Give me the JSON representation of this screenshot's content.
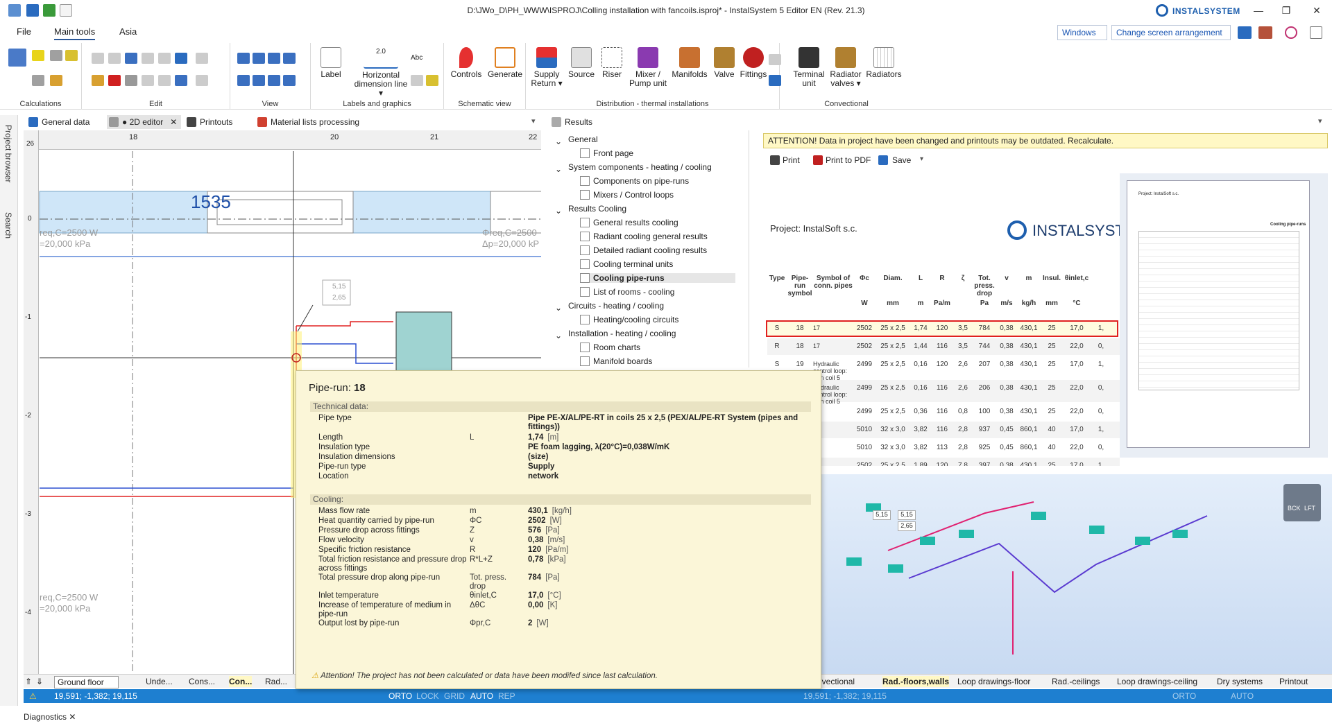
{
  "window": {
    "title": "D:\\JWo_D\\PH_WWW\\ISPROJ\\Colling installation with fancoils.isproj* - InstalSystem 5 Editor EN (Rev. 21.3)",
    "brand": "INSTALSYSTEM",
    "minimize": "—",
    "restore": "❐",
    "close": "✕"
  },
  "menu": {
    "file": "File",
    "main_tools": "Main tools",
    "asia": "Asia",
    "windows": "Windows ▾",
    "change_arrangement": "Change screen arrangement ▾"
  },
  "ribbon": {
    "groups": {
      "calculations": "Calculations",
      "edit": "Edit",
      "view": "View",
      "labels": "Labels and graphics",
      "schematic": "Schematic view",
      "distribution": "Distribution - thermal installations",
      "convectional": "Convectional"
    },
    "label": "Label",
    "horizontal_dimension": "Horizontal dimension line ▾",
    "dim_value": "2.0",
    "abc": "Abc",
    "controls": "Controls",
    "generate": "Generate",
    "supply_return": "Supply Return ▾",
    "source": "Source",
    "riser": "Riser",
    "mixer": "Mixer / Pump unit",
    "manifolds": "Manifolds",
    "valve": "Valve",
    "fittings": "Fittings",
    "terminal_unit": "Terminal unit",
    "radiator_valves": "Radiator valves ▾",
    "radiators": "Radiators"
  },
  "tabs": {
    "general_data": "General data",
    "editor_2d": "● 2D editor",
    "printouts": "Printouts",
    "material_lists": "Material lists processing",
    "results": "Results"
  },
  "side": {
    "project_browser": "Project browser",
    "search": "Search"
  },
  "canvas": {
    "ruler_top": [
      "18",
      "20",
      "21",
      "22"
    ],
    "ruler_left": [
      "26",
      "0",
      "-1",
      "-2",
      "-3",
      "-4"
    ],
    "room_number": "1535",
    "label1": "req,C=2500 W",
    "label2": "=20,000 kPa",
    "label3": "Φreq,C=2500",
    "label4": "Δp=20,000 kP",
    "label5": "req,C=2500 W",
    "label6": "=20,000 kPa",
    "dim_a": "5,15",
    "dim_b": "2,65"
  },
  "results_tree": [
    {
      "level": 0,
      "text": "General"
    },
    {
      "level": 1,
      "text": "Front page"
    },
    {
      "level": 0,
      "text": "System components - heating / cooling"
    },
    {
      "level": 1,
      "text": "Components on pipe-runs"
    },
    {
      "level": 1,
      "text": "Mixers / Control loops"
    },
    {
      "level": 0,
      "text": "Results Cooling"
    },
    {
      "level": 1,
      "text": "General results cooling"
    },
    {
      "level": 1,
      "text": "Radiant cooling general results"
    },
    {
      "level": 1,
      "text": "Detailed radiant cooling results"
    },
    {
      "level": 1,
      "text": "Cooling terminal units"
    },
    {
      "level": 1,
      "text": "Cooling pipe-runs"
    },
    {
      "level": 1,
      "text": "List of rooms - cooling"
    },
    {
      "level": 0,
      "text": "Circuits - heating / cooling"
    },
    {
      "level": 1,
      "text": "Heating/cooling circuits"
    },
    {
      "level": 0,
      "text": "Installation - heating / cooling"
    },
    {
      "level": 1,
      "text": "Room charts"
    },
    {
      "level": 1,
      "text": "Manifold boards"
    }
  ],
  "printout": {
    "attention": "ATTENTION! Data in project have been changed and printouts may be outdated. Recalculate.",
    "print": "Print",
    "print_pdf": "Print to PDF",
    "save": "Save",
    "project": "Project: InstalSoft s.c.",
    "logo": "INSTALSYST",
    "thumb_project": "Project: InstalSoft s.c.",
    "thumb_title": "Cooling pipe-runs",
    "headers": [
      "Type",
      "Pipe-run symbol",
      "Symbol of conn. pipes",
      "Φc",
      "Diam.",
      "L",
      "R",
      "ζ",
      "Tot. press. drop",
      "v",
      "m",
      "Insul.",
      "θinlet,c"
    ],
    "units": [
      "",
      "",
      "",
      "W",
      "mm",
      "m",
      "Pa/m",
      "",
      "Pa",
      "m/s",
      "kg/h",
      "mm",
      "°C"
    ],
    "rows": [
      [
        "S",
        "18",
        "17",
        "2502",
        "25 x 2,5",
        "1,74",
        "120",
        "3,5",
        "784",
        "0,38",
        "430,1",
        "25",
        "17,0",
        "1,"
      ],
      [
        "R",
        "18",
        "17",
        "2502",
        "25 x 2,5",
        "1,44",
        "116",
        "3,5",
        "744",
        "0,38",
        "430,1",
        "25",
        "22,0",
        "0,"
      ],
      [
        "S",
        "19",
        "Hydraulic control loop: Fan coil 5",
        "2499",
        "25 x 2,5",
        "0,16",
        "120",
        "2,6",
        "207",
        "0,38",
        "430,1",
        "25",
        "17,0",
        "1,"
      ],
      [
        "R",
        "19",
        "Hydraulic control loop: Fan coil 5",
        "2499",
        "25 x 2,5",
        "0,16",
        "116",
        "2,6",
        "206",
        "0,38",
        "430,1",
        "25",
        "22,0",
        "0,"
      ],
      [
        "",
        "",
        "",
        "2499",
        "25 x 2,5",
        "0,36",
        "116",
        "0,8",
        "100",
        "0,38",
        "430,1",
        "25",
        "22,0",
        "0,"
      ],
      [
        "",
        "",
        "7",
        "5010",
        "32 x 3,0",
        "3,82",
        "116",
        "2,8",
        "937",
        "0,45",
        "860,1",
        "40",
        "17,0",
        "1,"
      ],
      [
        "",
        "",
        "7",
        "5010",
        "32 x 3,0",
        "3,82",
        "113",
        "2,8",
        "925",
        "0,45",
        "860,1",
        "40",
        "22,0",
        "0,"
      ],
      [
        "",
        "",
        "",
        "2502",
        "25 x 2,5",
        "1,89",
        "120",
        "7,8",
        "397",
        "0,38",
        "430,1",
        "25",
        "17,0",
        "1,"
      ]
    ]
  },
  "view3d": {
    "dim_a": "5,15",
    "dim_b": "5,15",
    "dim_c": "2,65",
    "cube_left": "BCK",
    "cube_right": "LFT"
  },
  "tooltip": {
    "title_prefix": "Pipe-run: ",
    "title_value": "18",
    "tech_section": "Technical data:",
    "cooling_section": "Cooling:",
    "rows_tech": [
      {
        "name": "Pipe type",
        "sym": "",
        "val": "Pipe PE-X/AL/PE-RT in coils 25 x 2,5 (PEX/AL/PE-RT System (pipes and fittings))",
        "unit": ""
      },
      {
        "name": "Length",
        "sym": "L",
        "val": "1,74",
        "unit": "[m]"
      },
      {
        "name": "Insulation type",
        "sym": "",
        "val": "PE foam lagging, λ(20°C)=0,038W/mK",
        "unit": ""
      },
      {
        "name": "Insulation dimensions",
        "sym": "",
        "val": "(size)",
        "unit": ""
      },
      {
        "name": "Pipe-run type",
        "sym": "",
        "val": "Supply",
        "unit": ""
      },
      {
        "name": "Location",
        "sym": "",
        "val": "network",
        "unit": ""
      }
    ],
    "rows_cool": [
      {
        "name": "Mass flow rate",
        "sym": "m",
        "val": "430,1",
        "unit": "[kg/h]"
      },
      {
        "name": "Heat quantity carried by pipe-run",
        "sym": "ΦC",
        "val": "2502",
        "unit": "[W]"
      },
      {
        "name": "Pressure drop across fittings",
        "sym": "Z",
        "val": "576",
        "unit": "[Pa]"
      },
      {
        "name": "Flow velocity",
        "sym": "v",
        "val": "0,38",
        "unit": "[m/s]"
      },
      {
        "name": "Specific friction resistance",
        "sym": "R",
        "val": "120",
        "unit": "[Pa/m]"
      },
      {
        "name": "Total friction resistance and pressure drop across fittings",
        "sym": "R*L+Z",
        "val": "0,78",
        "unit": "[kPa]"
      },
      {
        "name": "Total pressure drop along pipe-run",
        "sym": "Tot. press. drop",
        "val": "784",
        "unit": "[Pa]"
      },
      {
        "name": "Inlet temperature",
        "sym": "θinlet,C",
        "val": "17,0",
        "unit": "[°C]"
      },
      {
        "name": "Increase of temperature of medium in pipe-run",
        "sym": "ΔθC",
        "val": "0,00",
        "unit": "[K]"
      },
      {
        "name": "Output lost by pipe-run",
        "sym": "Φpr,C",
        "val": "2",
        "unit": "[W]"
      }
    ],
    "note": "Attention! The project has not been calculated or data have been modifed since last calculation."
  },
  "bottom_tabs": {
    "ground_floor": "Ground floor",
    "unde": "Unde...",
    "cons": "Cons...",
    "con": "Con...",
    "rad": "Rad...",
    "convectional": "nvectional",
    "rad_floors": "Rad.-floors,walls",
    "loop_floor": "Loop drawings-floor",
    "rad_ceilings": "Rad.-ceilings",
    "loop_ceiling": "Loop drawings-ceiling",
    "dry": "Dry systems",
    "printout": "Printout"
  },
  "status": {
    "coords": "19,591; -1,382; 19,115",
    "orto": "ORTO",
    "lock": "LOCK",
    "grid": "GRID",
    "auto": "AUTO",
    "rep": "REP",
    "coords2": "19,591; -1,382; 19,115",
    "orto2": "ORTO",
    "auto2": "AUTO"
  },
  "diagnostics": "Diagnostics",
  "colors": {
    "accent": "#1e7fd0",
    "tooltip_bg": "#fbf6d8",
    "highlight_row": "#fffbe0",
    "highlight_border": "#e02020"
  }
}
